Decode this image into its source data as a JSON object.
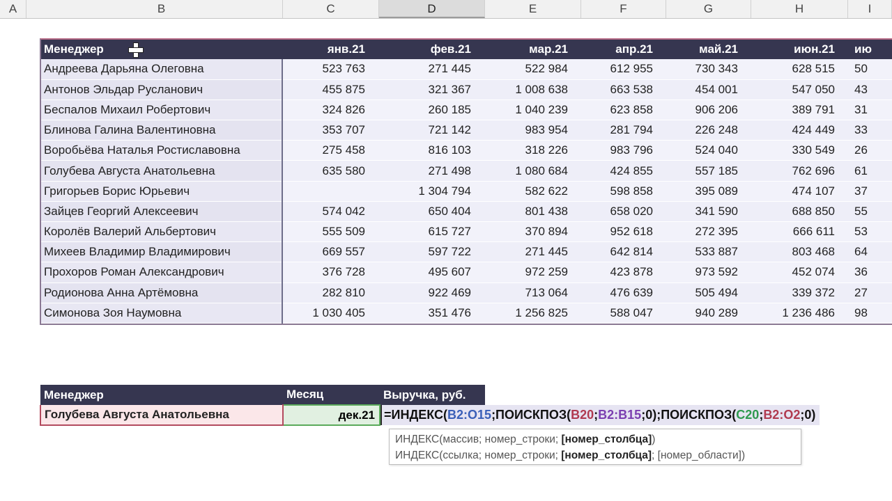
{
  "column_headers": [
    {
      "label": "A",
      "active": false
    },
    {
      "label": "B",
      "active": false
    },
    {
      "label": "C",
      "active": false
    },
    {
      "label": "D",
      "active": true
    },
    {
      "label": "E",
      "active": false
    },
    {
      "label": "F",
      "active": false
    },
    {
      "label": "G",
      "active": false
    },
    {
      "label": "H",
      "active": false
    },
    {
      "label": "I",
      "active": false
    }
  ],
  "main_table": {
    "header_manager": "Менеджер",
    "months": [
      "янв.21",
      "фев.21",
      "мар.21",
      "апр.21",
      "май.21",
      "июн.21",
      "ию"
    ],
    "rows": [
      {
        "name": "Андреева Дарьяна Олеговна",
        "values": [
          "523 763",
          "271 445",
          "522 984",
          "612 955",
          "730 343",
          "628 515",
          "50"
        ]
      },
      {
        "name": "Антонов Эльдар Русланович",
        "values": [
          "455 875",
          "321 367",
          "1 008 638",
          "663 538",
          "454 001",
          "547 050",
          "43"
        ]
      },
      {
        "name": "Беспалов Михаил Робертович",
        "values": [
          "324 826",
          "260 185",
          "1 040 239",
          "623 858",
          "906 206",
          "389 791",
          "31"
        ]
      },
      {
        "name": "Блинова Галина Валентиновна",
        "values": [
          "353 707",
          "721 142",
          "983 954",
          "281 794",
          "226 248",
          "424 449",
          "33"
        ]
      },
      {
        "name": "Воробьёва Наталья Ростиславовна",
        "values": [
          "275 458",
          "816 103",
          "318 226",
          "983 796",
          "524 040",
          "330 549",
          "26"
        ]
      },
      {
        "name": "Голубева Августа Анатольевна",
        "values": [
          "635 580",
          "271 498",
          "1 080 684",
          "424 855",
          "557 185",
          "762 696",
          "61"
        ]
      },
      {
        "name": "Григорьев Борис Юрьевич",
        "values": [
          "",
          "1 304 794",
          "582 622",
          "598 858",
          "395 089",
          "474 107",
          "37"
        ]
      },
      {
        "name": "Зайцев Георгий Алексеевич",
        "values": [
          "574 042",
          "650 404",
          "801 438",
          "658 020",
          "341 590",
          "688 850",
          "55"
        ]
      },
      {
        "name": "Королёв Валерий Альбертович",
        "values": [
          "555 509",
          "615 727",
          "370 894",
          "952 618",
          "272 395",
          "666 611",
          "53"
        ]
      },
      {
        "name": "Михеев Владимир Владимирович",
        "values": [
          "669 557",
          "597 722",
          "271 445",
          "642 814",
          "533 887",
          "803 468",
          "64"
        ]
      },
      {
        "name": "Прохоров Роман Александрович",
        "values": [
          "376 728",
          "495 607",
          "972 259",
          "423 878",
          "973 592",
          "452 074",
          "36"
        ]
      },
      {
        "name": "Родионова Анна Артёмовна",
        "values": [
          "282 810",
          "922 469",
          "713 064",
          "476 639",
          "505 494",
          "339 372",
          "27"
        ]
      },
      {
        "name": "Симонова Зоя Наумовна",
        "values": [
          "1 030 405",
          "351 476",
          "1 256 825",
          "588 047",
          "940 289",
          "1 236 486",
          "98"
        ]
      }
    ]
  },
  "lookup_table": {
    "header_manager": "Менеджер",
    "header_month": "Месяц",
    "header_revenue": "Выручка, руб.",
    "manager_value": "Голубева Августа Анатольевна",
    "month_value": "дек.21",
    "formula_parts": [
      {
        "text": "=ИНДЕКС(",
        "color": "default"
      },
      {
        "text": "B2:O15",
        "color": "blue"
      },
      {
        "text": ";ПОИСКПОЗ(",
        "color": "default"
      },
      {
        "text": "B20",
        "color": "red"
      },
      {
        "text": ";",
        "color": "default"
      },
      {
        "text": "B2:B15",
        "color": "purple"
      },
      {
        "text": ";0);ПОИСКПОЗ(",
        "color": "default"
      },
      {
        "text": "C20",
        "color": "green"
      },
      {
        "text": ";",
        "color": "default"
      },
      {
        "text": "B2:O2",
        "color": "red"
      },
      {
        "text": ";0)",
        "color": "default"
      }
    ]
  },
  "tooltip": {
    "line1_prefix": "ИНДЕКС(массив; номер_строки; ",
    "line1_bold": "[номер_столбца]",
    "line1_suffix": ")",
    "line2_prefix": "ИНДЕКС(ссылка; номер_строки; ",
    "line2_bold": "[номер_столбца]",
    "line2_suffix": "; [номер_области])"
  },
  "colors": {
    "header_bg": "#363650",
    "formula_blue": "#3a5fb8",
    "formula_red": "#b03a50",
    "formula_purple": "#7b3fb0",
    "formula_green": "#2f9a4f"
  }
}
